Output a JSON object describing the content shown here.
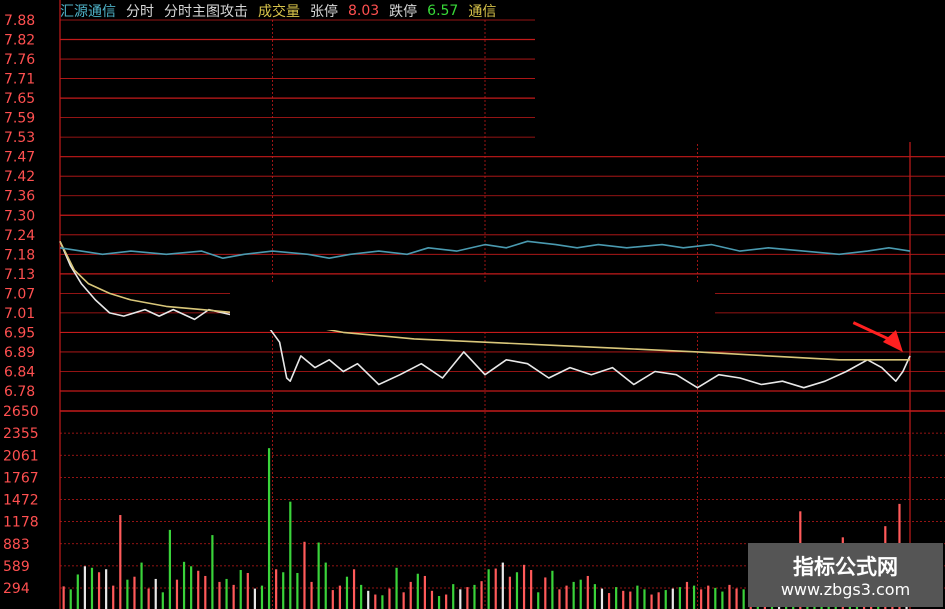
{
  "header": {
    "stock_name": "汇源通信",
    "tab_1": "分时",
    "tab_2": "分时主图攻击",
    "volume_label": "成交量",
    "limit_up_label": "张停",
    "limit_up_value": "8.03",
    "limit_down_label": "跌停",
    "limit_down_value": "6.57",
    "extra_label": "通信"
  },
  "watermark": {
    "line1": "指标公式网",
    "line2": "www.zbgs3.com"
  },
  "colors": {
    "grid": "#c41a1a",
    "price_line": "#e8e8e8",
    "avg_line": "#d9c77a",
    "index_line": "#4a9ab0",
    "up_bar": "#ff5a5a",
    "down_bar": "#3ad33a",
    "flat_bar": "#e8e8e8",
    "axis_text": "#ff5050",
    "arrow": "#ff2020"
  },
  "chart_data": {
    "type": "line",
    "price_ticks": [
      "7.88",
      "7.82",
      "7.76",
      "7.71",
      "7.65",
      "7.59",
      "7.53",
      "7.47",
      "7.42",
      "7.36",
      "7.30",
      "7.24",
      "7.18",
      "7.13",
      "7.07",
      "7.01",
      "6.95",
      "6.89",
      "6.84",
      "6.78"
    ],
    "volume_ticks": [
      "2650",
      "2355",
      "2061",
      "1767",
      "1472",
      "1178",
      "883",
      "589",
      "294"
    ],
    "ylim_price": [
      6.78,
      7.88
    ],
    "ylim_volume": [
      0,
      2650
    ],
    "reference_price": 7.3,
    "minutes": 240,
    "series": [
      {
        "key": "price",
        "x": [
          0,
          3,
          6,
          10,
          14,
          18,
          24,
          28,
          32,
          38,
          42,
          46,
          50,
          54,
          58,
          62,
          64,
          65,
          68,
          72,
          76,
          80,
          84,
          90,
          96,
          102,
          108,
          114,
          120,
          126,
          132,
          138,
          144,
          150,
          156,
          162,
          168,
          174,
          180,
          186,
          192,
          198,
          204,
          210,
          216,
          222,
          228,
          232,
          236,
          238,
          240
        ],
        "values": [
          7.22,
          7.15,
          7.1,
          7.05,
          7.01,
          7.0,
          7.02,
          7.0,
          7.02,
          6.99,
          7.02,
          7.01,
          7.0,
          6.99,
          6.98,
          6.92,
          6.82,
          6.81,
          6.88,
          6.85,
          6.87,
          6.84,
          6.86,
          6.8,
          6.83,
          6.86,
          6.82,
          6.89,
          6.83,
          6.87,
          6.86,
          6.82,
          6.85,
          6.83,
          6.85,
          6.8,
          6.84,
          6.83,
          6.79,
          6.83,
          6.82,
          6.8,
          6.81,
          6.79,
          6.81,
          6.84,
          6.87,
          6.85,
          6.81,
          6.84,
          6.88
        ]
      },
      {
        "key": "average",
        "x": [
          0,
          4,
          8,
          14,
          20,
          30,
          40,
          50,
          60,
          70,
          80,
          100,
          120,
          140,
          160,
          180,
          200,
          220,
          240
        ],
        "values": [
          7.22,
          7.14,
          7.1,
          7.07,
          7.05,
          7.03,
          7.02,
          7.01,
          7.0,
          6.97,
          6.95,
          6.93,
          6.92,
          6.91,
          6.9,
          6.89,
          6.88,
          6.87,
          6.87
        ]
      },
      {
        "key": "index",
        "x": [
          0,
          6,
          12,
          20,
          30,
          40,
          46,
          52,
          60,
          70,
          76,
          82,
          90,
          98,
          104,
          112,
          120,
          126,
          132,
          140,
          146,
          152,
          160,
          170,
          176,
          184,
          192,
          200,
          210,
          220,
          228,
          234,
          240
        ],
        "values": [
          7.2,
          7.19,
          7.18,
          7.19,
          7.18,
          7.19,
          7.17,
          7.18,
          7.19,
          7.18,
          7.17,
          7.18,
          7.19,
          7.18,
          7.2,
          7.19,
          7.21,
          7.2,
          7.22,
          7.21,
          7.2,
          7.21,
          7.2,
          7.21,
          7.2,
          7.21,
          7.19,
          7.2,
          7.19,
          7.18,
          7.19,
          7.2,
          7.19
        ]
      }
    ],
    "volume": {
      "x": [
        1,
        3,
        5,
        7,
        9,
        11,
        13,
        15,
        17,
        19,
        21,
        23,
        25,
        27,
        29,
        31,
        33,
        35,
        37,
        39,
        41,
        43,
        45,
        47,
        49,
        51,
        53,
        55,
        57,
        59,
        61,
        63,
        65,
        67,
        69,
        71,
        73,
        75,
        77,
        79,
        81,
        83,
        85,
        87,
        89,
        91,
        93,
        95,
        97,
        99,
        101,
        103,
        105,
        107,
        109,
        111,
        113,
        115,
        117,
        119,
        121,
        123,
        125,
        127,
        129,
        131,
        133,
        135,
        137,
        139,
        141,
        143,
        145,
        147,
        149,
        151,
        153,
        155,
        157,
        159,
        161,
        163,
        165,
        167,
        169,
        171,
        173,
        175,
        177,
        179,
        181,
        183,
        185,
        187,
        189,
        191,
        193,
        195,
        197,
        199,
        201,
        203,
        205,
        207,
        209,
        211,
        213,
        215,
        217,
        219,
        221,
        223,
        225,
        227,
        229,
        231,
        233,
        235,
        237,
        239
      ],
      "values": [
        290,
        250,
        450,
        560,
        540,
        480,
        520,
        300,
        1250,
        380,
        420,
        610,
        260,
        390,
        210,
        1050,
        380,
        620,
        560,
        500,
        430,
        980,
        350,
        390,
        310,
        510,
        470,
        260,
        300,
        2150,
        520,
        480,
        1430,
        470,
        890,
        350,
        880,
        610,
        240,
        300,
        420,
        520,
        310,
        230,
        180,
        170,
        260,
        540,
        210,
        350,
        460,
        430,
        230,
        160,
        180,
        320,
        250,
        280,
        310,
        360,
        520,
        530,
        610,
        420,
        480,
        580,
        510,
        210,
        410,
        500,
        250,
        300,
        350,
        380,
        430,
        320,
        260,
        200,
        280,
        230,
        220,
        300,
        250,
        180,
        210,
        240,
        260,
        280,
        350,
        300,
        250,
        300,
        270,
        220,
        310,
        260,
        250,
        300,
        260,
        300,
        270,
        330,
        230,
        400,
        1300,
        270,
        460,
        420,
        380,
        720,
        950,
        350,
        600,
        540,
        680,
        640,
        1100,
        350,
        1400,
        750
      ],
      "directions": [
        "u",
        "d",
        "d",
        "f",
        "d",
        "u",
        "f",
        "u",
        "u",
        "d",
        "u",
        "d",
        "u",
        "f",
        "d",
        "d",
        "u",
        "d",
        "d",
        "u",
        "u",
        "d",
        "u",
        "d",
        "u",
        "d",
        "u",
        "f",
        "d",
        "d",
        "u",
        "d",
        "d",
        "d",
        "u",
        "u",
        "d",
        "d",
        "u",
        "u",
        "d",
        "u",
        "d",
        "f",
        "u",
        "d",
        "u",
        "d",
        "u",
        "u",
        "d",
        "u",
        "u",
        "d",
        "u",
        "d",
        "f",
        "u",
        "d",
        "u",
        "d",
        "u",
        "f",
        "u",
        "d",
        "u",
        "u",
        "d",
        "u",
        "d",
        "u",
        "u",
        "d",
        "d",
        "u",
        "d",
        "f",
        "u",
        "d",
        "u",
        "u",
        "d",
        "d",
        "u",
        "u",
        "d",
        "f",
        "d",
        "u",
        "d",
        "u",
        "u",
        "d",
        "d",
        "u",
        "u",
        "d",
        "u",
        "d",
        "u",
        "d",
        "f",
        "d",
        "d",
        "u",
        "d",
        "d",
        "d",
        "d",
        "d",
        "u",
        "d",
        "d",
        "u",
        "u",
        "d",
        "u",
        "u",
        "u",
        "f"
      ]
    },
    "arrow": {
      "from": [
        224,
        6.98
      ],
      "to": [
        238,
        6.89
      ]
    }
  }
}
